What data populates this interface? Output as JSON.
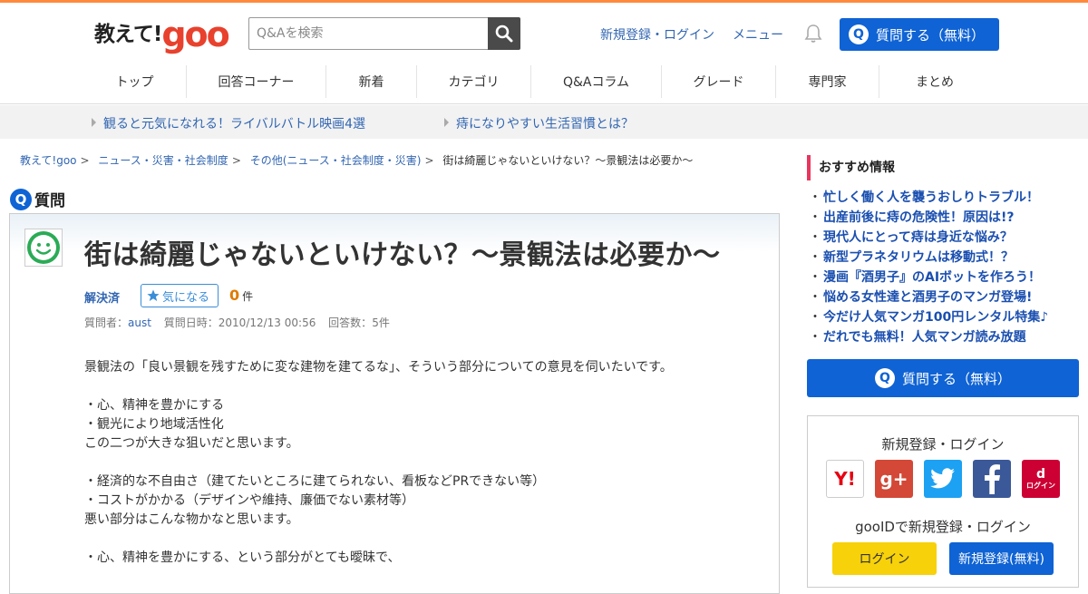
{
  "header": {
    "logo_text": "教えて!",
    "logo_brand": "goo",
    "search_placeholder": "Q&Aを検索",
    "signup_login": "新規登録・ログイン",
    "menu": "メニュー",
    "ask_button": "質問する（無料）",
    "ask_icon": "Q"
  },
  "nav": {
    "items": [
      "トップ",
      "回答コーナー",
      "新着",
      "カテゴリ",
      "Q&Aコラム",
      "グレード",
      "専門家",
      "まとめ"
    ]
  },
  "promo": {
    "items": [
      "観ると元気になれる！ライバルバトル映画4選",
      "痔になりやすい生活習慣とは？"
    ]
  },
  "breadcrumb": {
    "items": [
      "教えて!goo",
      "ニュース・災害・社会制度",
      "その他(ニュース・社会制度・災害)",
      "街は綺麗じゃないといけない？～景観法は必要か～"
    ]
  },
  "question": {
    "section_label": "質問",
    "title": "街は綺麗じゃないといけない？～景観法は必要か～",
    "status": "解決済",
    "watch_label": "気になる",
    "watch_count": "0",
    "count_unit": "件",
    "meta": {
      "asker_label": "質問者：",
      "asker": "aust",
      "date_label": "質問日時：",
      "date": "2010/12/13 00:56",
      "answers_label": "回答数：",
      "answers": "5件"
    },
    "body": [
      "景観法の「良い景観を残すために変な建物を建てるな」、そういう部分についての意見を伺いたいです。",
      "",
      "・心、精神を豊かにする",
      "・観光により地域活性化",
      "この二つが大きな狙いだと思います。",
      "",
      "・経済的な不自由さ（建てたいところに建てられない、看板などPRできない等）",
      "・コストがかかる（デザインや維持、廉価でない素材等）",
      "悪い部分はこんな物かなと思います。",
      "",
      "・心、精神を豊かにする、という部分がとても曖昧で、"
    ]
  },
  "sidebar": {
    "recommend_title": "おすすめ情報",
    "recommend_items": [
      "忙しく働く人を襲うおしりトラブル！",
      "出産前後に痔の危険性！原因は!?",
      "現代人にとって痔は身近な悩み？",
      "新型プラネタリウムは移動式！？",
      "漫画『酒男子』のAIボットを作ろう！",
      "悩める女性達と酒男子のマンガ登場!",
      "今だけ人気マンガ100円レンタル特集♪",
      "だれでも無料！人気マンガ読み放題"
    ],
    "ask_button": "質問する（無料）",
    "login_title": "新規登録・ログイン",
    "sns": {
      "yahoo": "Y!",
      "google": "g+",
      "docomo_label": "ログイン",
      "docomo_mark": "d"
    },
    "gooid_title": "gooIDで新規登録・ログイン",
    "login_button": "ログイン",
    "signup_button": "新規登録(無料)"
  },
  "colors": {
    "accent_blue": "#0f63d4",
    "top_line": "#ff8a3d",
    "link": "#3266b2",
    "logo_red": "#e8412d",
    "recommend_bar": "#e8365d",
    "login_yellow": "#f7d10a"
  }
}
